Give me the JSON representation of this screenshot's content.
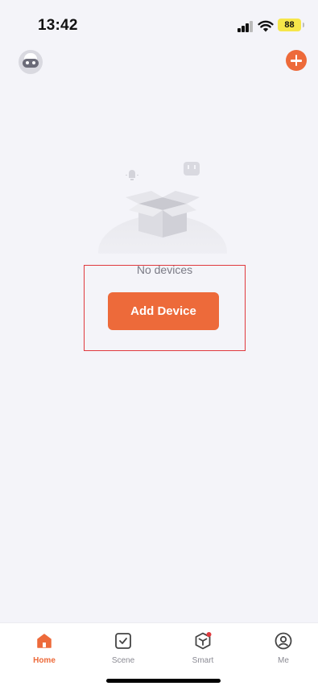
{
  "status_bar": {
    "time": "13:42",
    "battery": "88",
    "icons": [
      "signal-icon",
      "wifi-icon",
      "battery-icon"
    ]
  },
  "header": {
    "icons": [
      "avatar-icon",
      "add-icon"
    ]
  },
  "empty_state": {
    "message": "No devices",
    "button_label": "Add Device"
  },
  "tab_bar": {
    "tabs": [
      {
        "label": "Home",
        "icon": "home-icon",
        "active": true
      },
      {
        "label": "Scene",
        "icon": "scene-checkbox-icon",
        "active": false
      },
      {
        "label": "Smart",
        "icon": "smart-cube-icon",
        "active": false
      },
      {
        "label": "Me",
        "icon": "profile-icon",
        "active": false
      }
    ]
  },
  "colors": {
    "accent": "#ed6a3a",
    "background": "#f4f4f9",
    "highlight_border": "#e0393e",
    "battery": "#f6e64a"
  }
}
